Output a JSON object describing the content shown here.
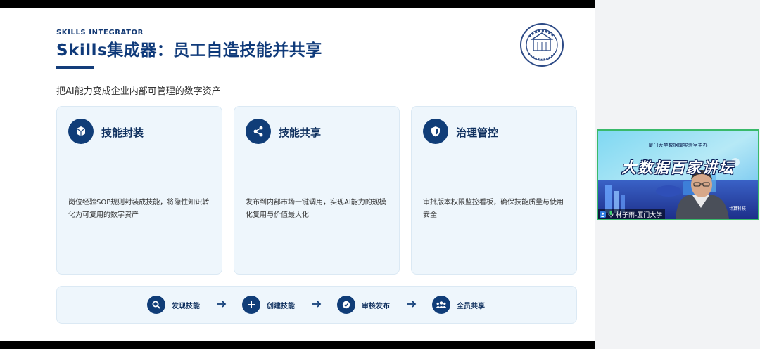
{
  "slide": {
    "eyebrow": "SKILLS INTEGRATOR",
    "title": "Skills集成器：员工自造技能并共享",
    "subtitle": "把AI能力变成企业内部可管理的数字资产",
    "accent": "#103d78",
    "cards": [
      {
        "icon": "cube-icon",
        "title": "技能封装",
        "desc": "岗位经验SOP规则封装成技能，将隐性知识转化为可复用的数字资产"
      },
      {
        "icon": "share-icon",
        "title": "技能共享",
        "desc": "发布到内部市场一键调用，实现AI能力的规模化复用与价值最大化"
      },
      {
        "icon": "shield-icon",
        "title": "治理管控",
        "desc": "审批版本权限监控看板，确保技能质量与使用安全"
      }
    ],
    "flow": [
      {
        "icon": "search-icon",
        "label": "发现技能"
      },
      {
        "icon": "plus-icon",
        "label": "创建技能"
      },
      {
        "icon": "check-icon",
        "label": "审核发布"
      },
      {
        "icon": "group-icon",
        "label": "全员共享"
      }
    ]
  },
  "webcam": {
    "top_text": "厦门大学数据库实验室主办",
    "banner": "大数据百家讲坛",
    "corner": "计算科技",
    "participant": "林子雨-厦门大学"
  }
}
